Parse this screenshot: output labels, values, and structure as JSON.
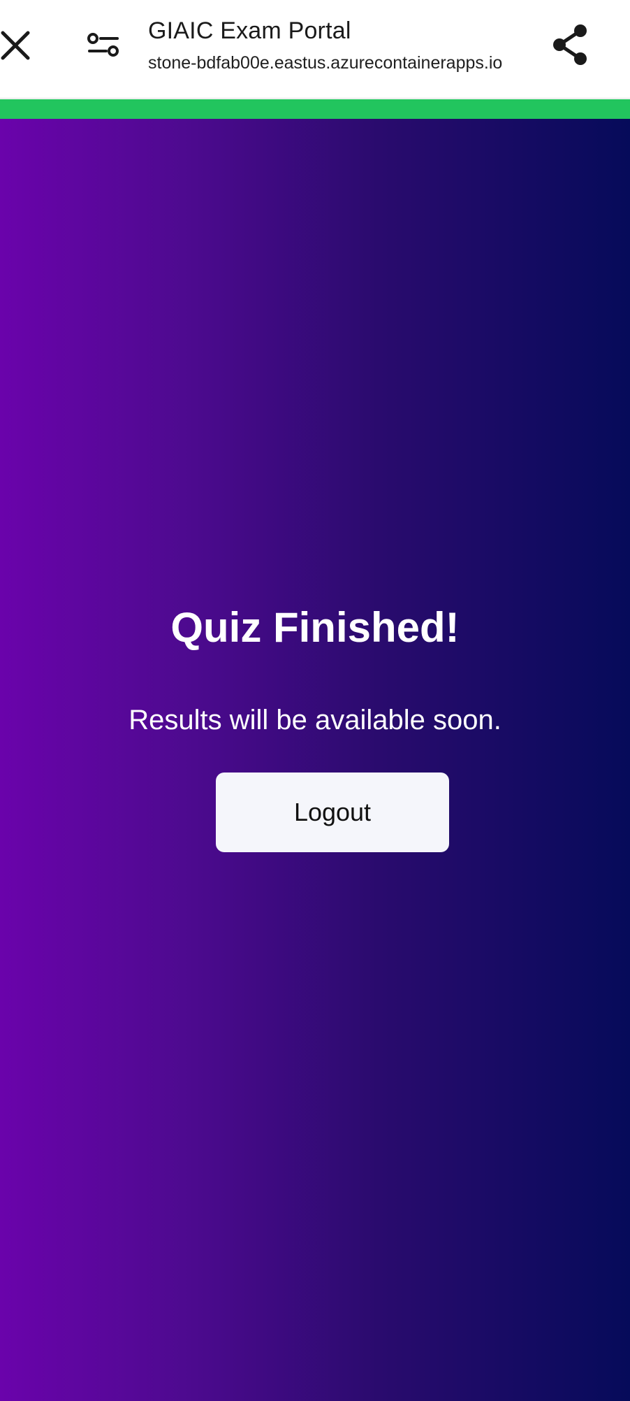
{
  "browser": {
    "title": "GIAIC Exam Portal",
    "url": "stone-bdfab00e.eastus.azurecontainerapps.io",
    "icons": {
      "close": "close-icon",
      "settings": "tune-icon",
      "share": "share-icon"
    }
  },
  "progress": {
    "color": "#22c55e",
    "fraction": 1.0
  },
  "main": {
    "heading": "Quiz Finished!",
    "message": "Results will be available soon.",
    "logout_label": "Logout",
    "gradient_colors": [
      "#6a03ab",
      "#060b5a"
    ]
  }
}
